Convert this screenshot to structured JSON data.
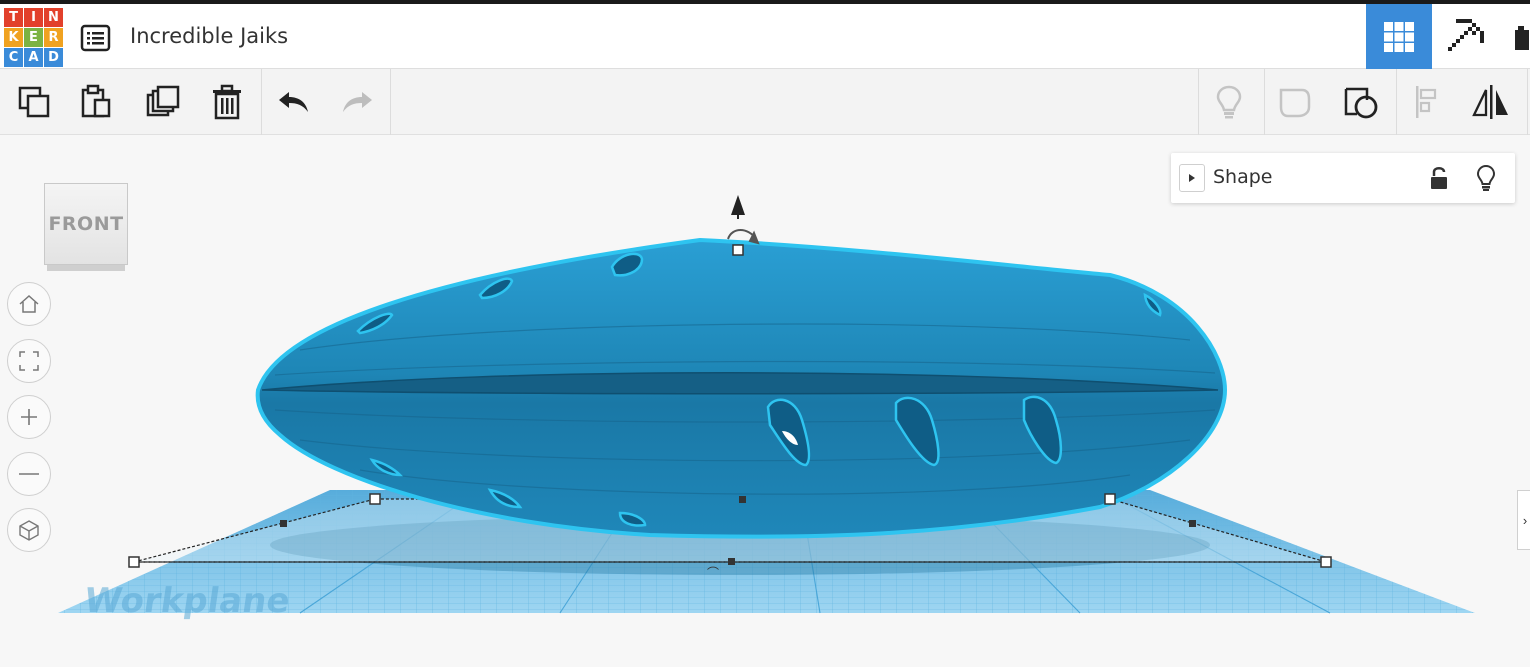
{
  "app": {
    "title": "Incredible Jaiks",
    "logo_letters": [
      "T",
      "I",
      "N",
      "K",
      "E",
      "R",
      "C",
      "A",
      "D"
    ],
    "logo_colors": [
      "#e2402b",
      "#e2402b",
      "#e2402b",
      "#f0a220",
      "#f0a220",
      "#f0a220",
      "#3a8bd9",
      "#3a8bd9",
      "#3a8bd9"
    ]
  },
  "header": {
    "menu_icon": "list-icon",
    "view_buttons": [
      {
        "name": "3d-design-view",
        "icon": "grid-icon",
        "active": true
      },
      {
        "name": "minecraft-view",
        "icon": "pickaxe-icon",
        "active": false
      },
      {
        "name": "bricks-view",
        "icon": "brick-icon",
        "active": false
      }
    ]
  },
  "toolbar": {
    "left": [
      "copy-icon",
      "paste-icon",
      "duplicate-icon",
      "trash-icon",
      "undo-icon",
      "redo-icon"
    ],
    "right": [
      "lightbulb-icon",
      "note-icon",
      "ruler-icon",
      "align-icon",
      "mirror-icon"
    ]
  },
  "viewcube": {
    "label": "FRONT"
  },
  "nav": [
    "home-icon",
    "fit-view-icon",
    "zoom-in-icon",
    "zoom-out-icon",
    "perspective-cube-icon"
  ],
  "inspector": {
    "title": "Shape",
    "icons": [
      "unlock-icon",
      "lightbulb-icon"
    ]
  },
  "workplane": {
    "label": "Workplane"
  },
  "colors": {
    "accent": "#3a8bd9",
    "shape": "#1e86b6",
    "outline": "#2ec4f0",
    "grid": "#7fc6ea"
  }
}
